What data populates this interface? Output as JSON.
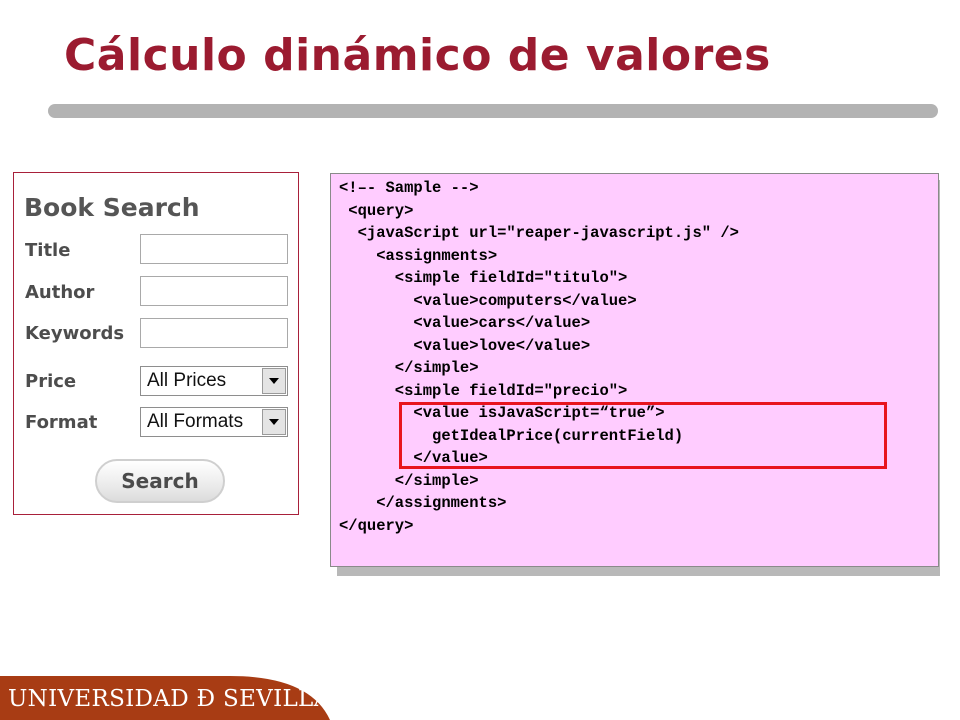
{
  "slide": {
    "title": "Cálculo dinámico de valores"
  },
  "book_search": {
    "heading": "Book Search",
    "fields": [
      {
        "label": "Title",
        "value": ""
      },
      {
        "label": "Author",
        "value": ""
      },
      {
        "label": "Keywords",
        "value": ""
      }
    ],
    "selects": [
      {
        "label": "Price",
        "selected": "All Prices"
      },
      {
        "label": "Format",
        "selected": "All Formats"
      }
    ],
    "search_button_label": "Search"
  },
  "code": {
    "lines": [
      "<!–- Sample -->",
      " <query>",
      "  <javaScript url=\"reaper-javascript.js\" />",
      "    <assignments>",
      "      <simple fieldId=\"titulo\">",
      "        <value>computers</value>",
      "        <value>cars</value>",
      "        <value>love</value>",
      "      </simple>",
      "      <simple fieldId=\"precio\">",
      "        <value isJavaScript=“true”>",
      "          getIdealPrice(currentField)",
      "        </value>",
      "      </simple>",
      "    </assignments>",
      "</query>"
    ],
    "highlight_color": "#e8141e",
    "background_color": "#ffccff"
  },
  "footer": {
    "logo_text": "UNIVERSIDAD Ð SEVILLA",
    "band_color": "#a83c14"
  },
  "colors": {
    "title": "#9b1b30",
    "rule": "#b3b3b3"
  }
}
